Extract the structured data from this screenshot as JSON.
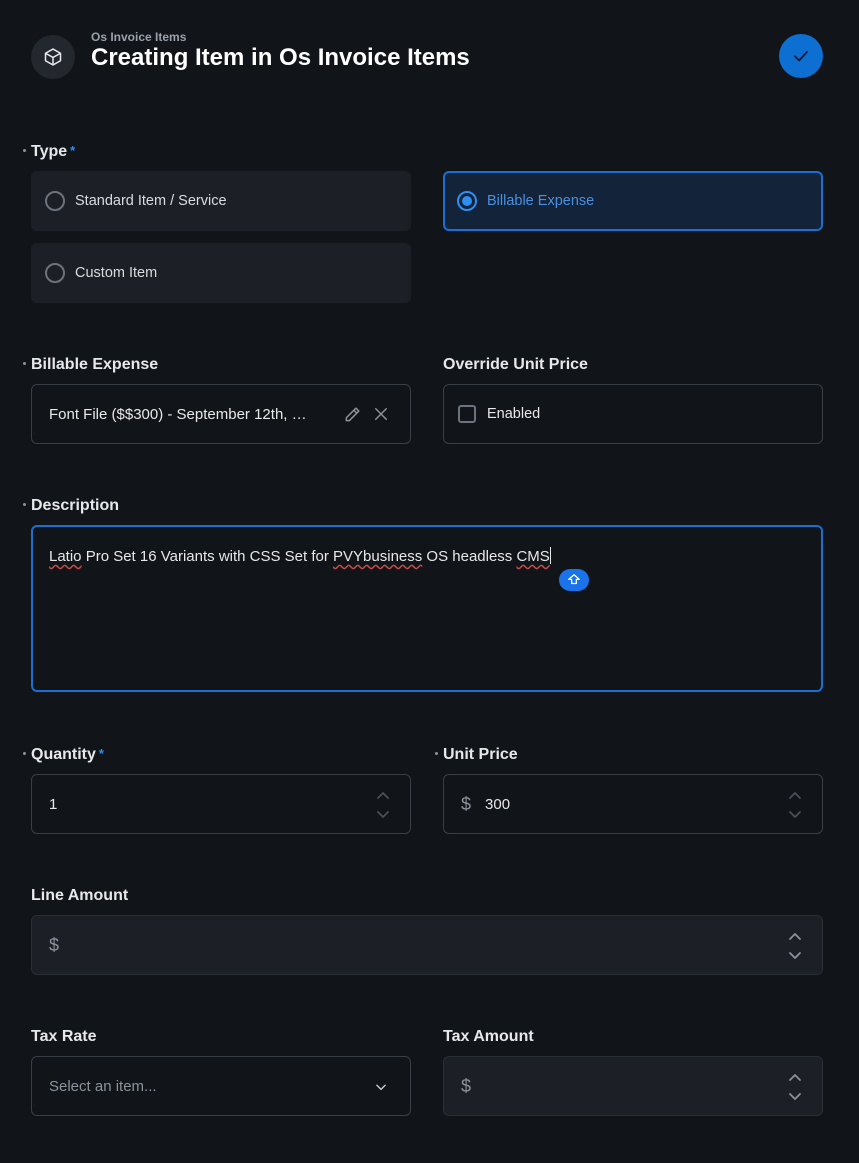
{
  "header": {
    "breadcrumb": "Os Invoice Items",
    "title": "Creating Item in Os Invoice Items",
    "icon": "cube-icon",
    "save_icon": "check-icon"
  },
  "type_field": {
    "label": "Type",
    "required_mark": "*",
    "options": [
      {
        "label": "Standard Item / Service",
        "selected": false
      },
      {
        "label": "Billable Expense",
        "selected": true
      },
      {
        "label": "Custom Item",
        "selected": false
      }
    ]
  },
  "billable_expense": {
    "label": "Billable Expense",
    "value": "Font File ($$300) - September 12th, …",
    "edit_icon": "pencil-icon",
    "clear_icon": "close-icon"
  },
  "override_unit_price": {
    "label": "Override Unit Price",
    "checkbox_label": "Enabled",
    "checked": false
  },
  "description": {
    "label": "Description",
    "value": "Latio Pro Set 16 Variants with CSS Set for PVYbusiness OS headless CMS",
    "parts": {
      "w1": "Latio",
      "w2": " Pro Set 16 Variants with CSS Set for ",
      "w3": "PVYbusiness",
      "w4": " OS headless ",
      "w5": "CMS"
    }
  },
  "quantity": {
    "label": "Quantity",
    "required_mark": "*",
    "value": "1"
  },
  "unit_price": {
    "label": "Unit Price",
    "currency": "$",
    "value": "300"
  },
  "line_amount": {
    "label": "Line Amount",
    "currency": "$",
    "value": ""
  },
  "tax_rate": {
    "label": "Tax Rate",
    "placeholder": "Select an item..."
  },
  "tax_amount": {
    "label": "Tax Amount",
    "currency": "$",
    "value": ""
  },
  "colors": {
    "accent": "#0c6fd1",
    "background": "#111418",
    "card": "#1c1f25"
  }
}
